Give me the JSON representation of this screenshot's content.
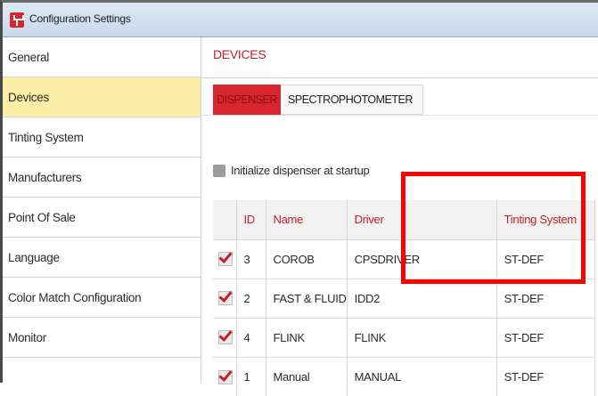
{
  "window": {
    "title": "Configuration Settings",
    "icon": "app-logo-icon"
  },
  "sidebar": {
    "items": [
      {
        "label": "General",
        "active": false
      },
      {
        "label": "Devices",
        "active": true
      },
      {
        "label": "Tinting System",
        "active": false
      },
      {
        "label": "Manufacturers",
        "active": false
      },
      {
        "label": "Point Of Sale",
        "active": false
      },
      {
        "label": "Language",
        "active": false
      },
      {
        "label": "Color Match Configuration",
        "active": false
      },
      {
        "label": "Monitor",
        "active": false
      }
    ]
  },
  "main": {
    "section_title": "DEVICES",
    "tabs": [
      {
        "label": "DISPENSER",
        "active": true
      },
      {
        "label": "SPECTROPHOTOMETER",
        "active": false
      }
    ],
    "init_checkbox": {
      "label": "Initialize dispenser at startup",
      "checked": false
    },
    "table": {
      "columns": [
        "ID",
        "Name",
        "Driver",
        "Tinting System"
      ],
      "rows": [
        {
          "checked": true,
          "id": "3",
          "name": "COROB",
          "driver": "CPSDRIVER",
          "tinting_system": "ST-DEF"
        },
        {
          "checked": true,
          "id": "2",
          "name": "FAST & FLUID",
          "driver": "IDD2",
          "tinting_system": "ST-DEF"
        },
        {
          "checked": true,
          "id": "4",
          "name": "FLINK",
          "driver": "FLINK",
          "tinting_system": "ST-DEF"
        },
        {
          "checked": true,
          "id": "1",
          "name": "Manual",
          "driver": "MANUAL",
          "tinting_system": "ST-DEF"
        }
      ]
    }
  },
  "colors": {
    "accent": "#d8262e",
    "active_nav": "#fbeea6",
    "highlight_box": "#ff0000"
  }
}
